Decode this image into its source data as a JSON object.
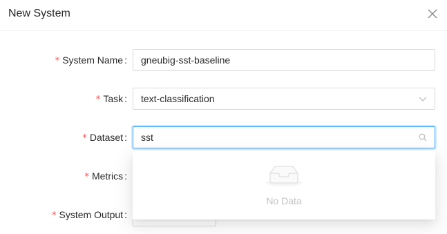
{
  "modal": {
    "title": "New System",
    "close_icon": "close-icon"
  },
  "form": {
    "system_name": {
      "label": "System Name",
      "value": "gneubig-sst-baseline",
      "required": true
    },
    "task": {
      "label": "Task",
      "value": "text-classification",
      "required": true,
      "icon": "chevron-down-icon"
    },
    "dataset": {
      "label": "Dataset",
      "value": "sst",
      "required": true,
      "icon": "search-icon",
      "dropdown_empty_text": "No Data"
    },
    "metrics": {
      "label": "Metrics",
      "required": true
    },
    "system_output": {
      "label": "System Output",
      "required": true
    }
  },
  "symbols": {
    "required_mark": "*",
    "colon": ":"
  },
  "colors": {
    "required": "#ff4d4f",
    "focus_border": "#40a9ff",
    "border": "#d9d9d9"
  }
}
